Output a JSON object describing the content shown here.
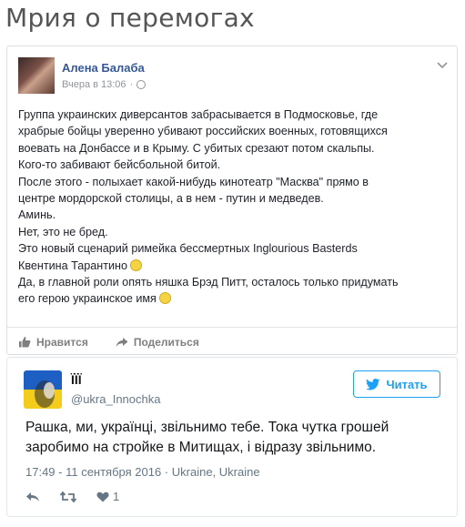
{
  "page": {
    "title": "Мрия о перемогах"
  },
  "facebook_post": {
    "author": "Алена Балаба",
    "timestamp": "Вчера в 13:06",
    "separator": "·",
    "body_lines": [
      "Группа украинских диверсантов забрасывается в Подмосковье, где",
      "храбрые бойцы уверенно убивают российских военных, готовящихся",
      "воевать на Донбассе и в Крыму. С убитых срезают потом скальпы.",
      "Кого-то забивают бейсбольной битой.",
      "После этого - полыхает какой-нибудь кинотеатр \"Масква\" прямо в",
      "центре мордорской столицы, а в нем - путин и медведев.",
      "Аминь.",
      "Нет, это не бред.",
      "Это новый сценарий римейка бессмертных Inglourious Basterds",
      "Квентина Тарантино",
      "Да, в главной роли опять няшка Брэд Питт, осталось только придумать",
      "его герою украинское имя"
    ],
    "actions": {
      "like_label": "Нравится",
      "share_label": "Поделиться"
    }
  },
  "tweet": {
    "name": "ÏÏÏ",
    "handle": "@ukra_Innochka",
    "follow_label": "Читать",
    "text_line1": "Рашка, ми, українці, звільнимо тебе. Тока чутка грошей",
    "text_line2": "заробимо на стройке в Митищах, і відразу звільнимо.",
    "meta": "17:49 - 11 сентября 2016 · Ukraine, Ukraine",
    "like_count": "1"
  },
  "colors": {
    "fb_link": "#365899",
    "twitter_blue": "#1da1f2"
  }
}
